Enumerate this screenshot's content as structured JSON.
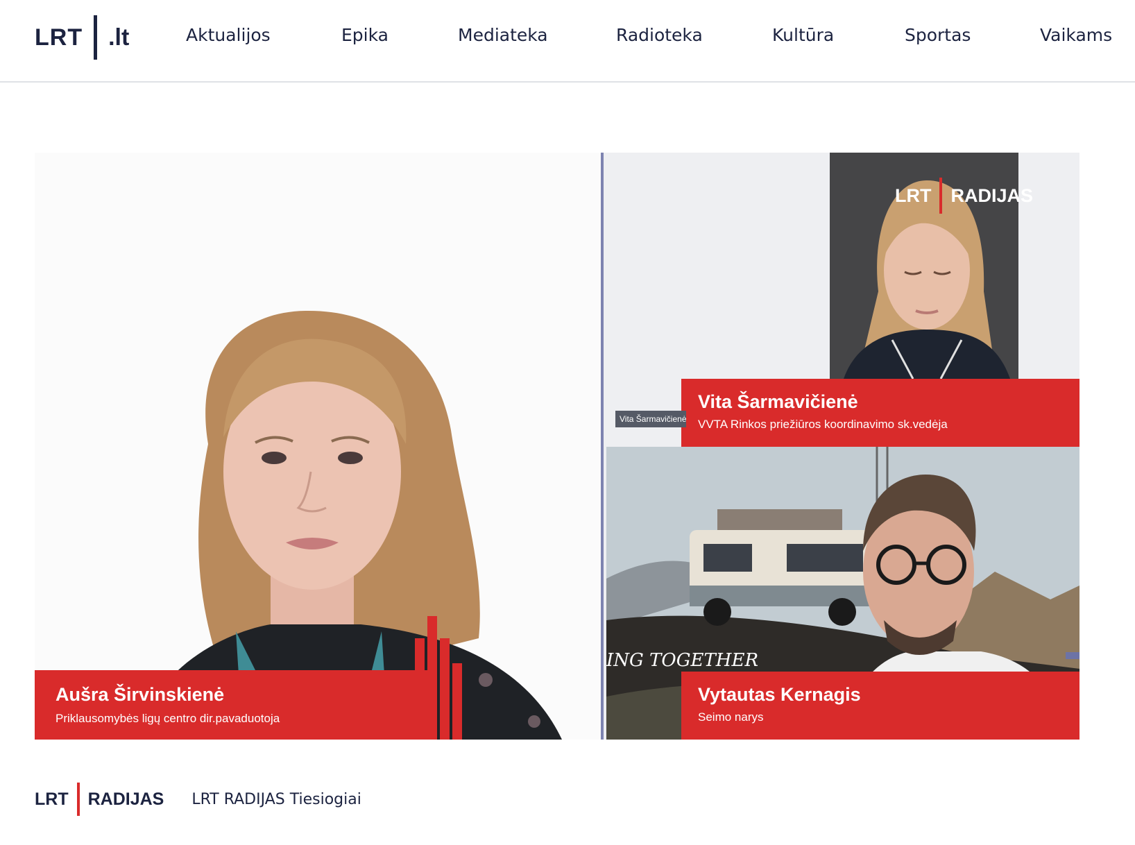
{
  "header": {
    "logo": {
      "brand": "LRT",
      "suffix": ".lt"
    },
    "nav": [
      {
        "label": "Aktualijos"
      },
      {
        "label": "Epika"
      },
      {
        "label": "Mediateka"
      },
      {
        "label": "Radioteka"
      },
      {
        "label": "Kultūra"
      },
      {
        "label": "Sportas"
      },
      {
        "label": "Vaikams"
      }
    ]
  },
  "video": {
    "watermark": {
      "brand": "LRT",
      "channel": "RADIJAS"
    },
    "participants": [
      {
        "name": "Aušra Širvinskienė",
        "role": "Priklausomybės ligų centro dir.pavaduotoja"
      },
      {
        "name": "Vita Šarmavičienė",
        "role": "VVTA Rinkos priežiūros koordinavimo sk.vedėja"
      },
      {
        "name": "Vytautas Kernagis",
        "role": "Seimo narys"
      }
    ],
    "small_tag": "Vita Šarmavičienė",
    "poster_text": "ING TOGETHER"
  },
  "footer": {
    "brand": "LRT",
    "channel": "RADIJAS",
    "text": "LRT RADIJAS Tiesiogiai"
  },
  "colors": {
    "navy": "#1c2340",
    "red": "#d92b2b",
    "divider": "#7d83b0"
  }
}
